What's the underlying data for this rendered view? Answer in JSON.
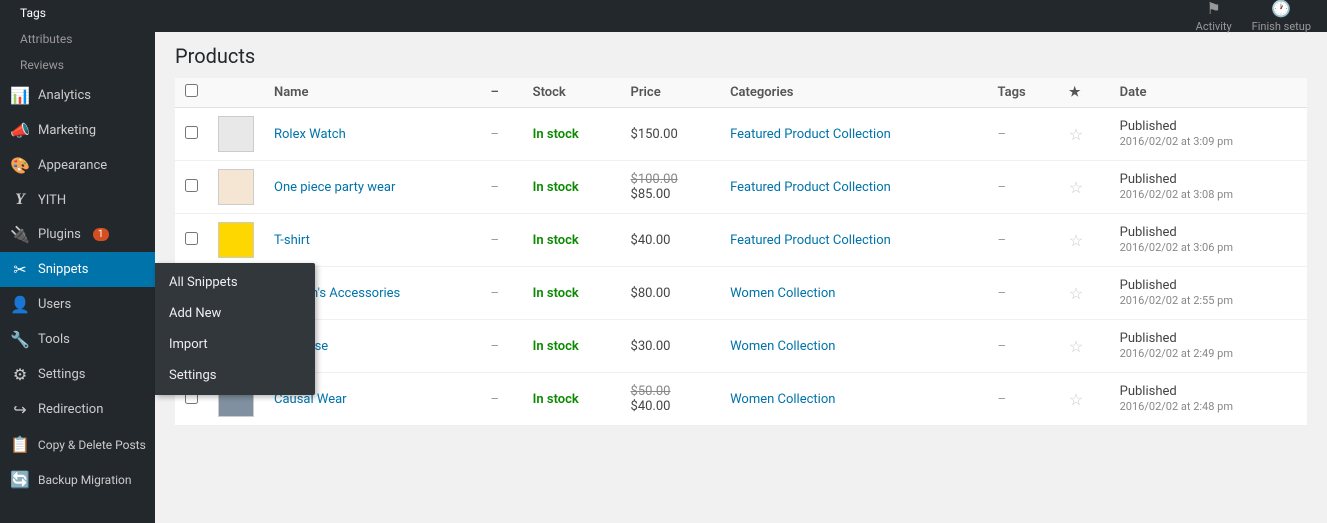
{
  "sidebar": {
    "items": [
      {
        "id": "analytics",
        "label": "Analytics",
        "icon": "📊"
      },
      {
        "id": "marketing",
        "label": "Marketing",
        "icon": "📣"
      },
      {
        "id": "appearance",
        "label": "Appearance",
        "icon": "🎨"
      },
      {
        "id": "yith",
        "label": "YITH",
        "icon": "Y"
      },
      {
        "id": "plugins",
        "label": "Plugins",
        "icon": "🔌",
        "badge": "1"
      },
      {
        "id": "snippets",
        "label": "Snippets",
        "icon": "✂",
        "active": true
      },
      {
        "id": "users",
        "label": "Users",
        "icon": "👤"
      },
      {
        "id": "tools",
        "label": "Tools",
        "icon": "🔧"
      },
      {
        "id": "settings",
        "label": "Settings",
        "icon": "⚙"
      },
      {
        "id": "redirection",
        "label": "Redirection",
        "icon": "↪"
      },
      {
        "id": "copy-delete",
        "label": "Copy & Delete Posts",
        "icon": "📋"
      },
      {
        "id": "backup",
        "label": "Backup Migration",
        "icon": "🔄"
      }
    ],
    "sub_links": [
      {
        "id": "tags",
        "label": "Tags"
      },
      {
        "id": "attributes",
        "label": "Attributes"
      },
      {
        "id": "reviews",
        "label": "Reviews"
      }
    ]
  },
  "submenu": {
    "items": [
      {
        "id": "all-snippets",
        "label": "All Snippets"
      },
      {
        "id": "add-new",
        "label": "Add New"
      },
      {
        "id": "import",
        "label": "Import"
      },
      {
        "id": "settings",
        "label": "Settings"
      }
    ]
  },
  "topbar": {
    "activity_label": "Activity",
    "finish_setup_label": "Finish setup"
  },
  "page": {
    "title": "Products"
  },
  "table": {
    "columns": [
      "",
      "",
      "Name",
      "–",
      "Stock",
      "Price",
      "Categories",
      "Tags",
      "★",
      "Date"
    ],
    "rows": [
      {
        "id": 1,
        "name": "Rolex Watch",
        "stock": "In stock",
        "price_display": "$150.00",
        "price_old": "",
        "price_new": "$150.00",
        "categories": "Featured Product Collection",
        "tags": "–",
        "status": "Published",
        "date": "2016/02/02 at 3:09 pm",
        "thumb_color": "#e8e8e8"
      },
      {
        "id": 2,
        "name": "One piece party wear",
        "stock": "In stock",
        "price_display": "$100.00 / $85.00",
        "price_old": "$100.00",
        "price_new": "$85.00",
        "categories": "Featured Product Collection",
        "tags": "–",
        "status": "Published",
        "date": "2016/02/02 at 3:08 pm",
        "thumb_color": "#f5e6d3"
      },
      {
        "id": 3,
        "name": "T-shirt",
        "stock": "In stock",
        "price_display": "$40.00",
        "price_old": "",
        "price_new": "$40.00",
        "categories": "Featured Product Collection",
        "tags": "–",
        "status": "Published",
        "date": "2016/02/02 at 3:06 pm",
        "thumb_color": "#ffd700"
      },
      {
        "id": 4,
        "name": "Women's Accessories",
        "stock": "In stock",
        "price_display": "$80.00",
        "price_old": "",
        "price_new": "$80.00",
        "categories": "Women Collection",
        "tags": "–",
        "status": "Published",
        "date": "2016/02/02 at 2:55 pm",
        "thumb_color": "#d8c8b8"
      },
      {
        "id": 5,
        "name": "Converse",
        "stock": "In stock",
        "price_display": "$30.00",
        "price_old": "",
        "price_new": "$30.00",
        "categories": "Women Collection",
        "tags": "–",
        "status": "Published",
        "date": "2016/02/02 at 2:49 pm",
        "thumb_color": "#c8d8e8"
      },
      {
        "id": 6,
        "name": "Causal Wear",
        "stock": "In stock",
        "price_display": "$50.00 / $40.00",
        "price_old": "$50.00",
        "price_new": "$40.00",
        "categories": "Women Collection",
        "tags": "–",
        "status": "Published",
        "date": "2016/02/02 at 2:48 pm",
        "thumb_color": "#8090a0"
      }
    ]
  }
}
